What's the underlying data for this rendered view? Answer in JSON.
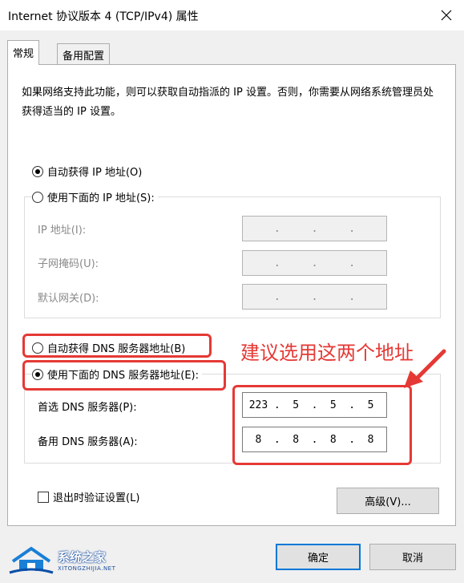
{
  "window": {
    "title": "Internet 协议版本 4 (TCP/IPv4) 属性"
  },
  "tabs": {
    "general": "常规",
    "alternate": "备用配置"
  },
  "description": "如果网络支持此功能，则可以获取自动指派的 IP 设置。否则，你需要从网络系统管理员处获得适当的 IP 设置。",
  "ip": {
    "auto_label": "自动获得 IP 地址(O)",
    "manual_label": "使用下面的 IP 地址(S):",
    "address_label": "IP 地址(I):",
    "subnet_label": "子网掩码(U):",
    "gateway_label": "默认网关(D):",
    "dot": "."
  },
  "dns": {
    "auto_label": "自动获得 DNS 服务器地址(B)",
    "manual_label": "使用下面的 DNS 服务器地址(E):",
    "preferred_label": "首选 DNS 服务器(P):",
    "alternate_label": "备用 DNS 服务器(A):",
    "preferred": [
      "223",
      "5",
      "5",
      "5"
    ],
    "alternate": [
      "8",
      "8",
      "8",
      "8"
    ]
  },
  "validate_label": "退出时验证设置(L)",
  "buttons": {
    "advanced": "高级(V)...",
    "ok": "确定",
    "cancel": "取消"
  },
  "annotation": "建议选用这两个地址",
  "watermark": {
    "name": "系统之家",
    "url": "XITONGZHIJIA.NET"
  },
  "colors": {
    "highlight_red": "#e53935",
    "accent_blue": "#0078d7"
  }
}
